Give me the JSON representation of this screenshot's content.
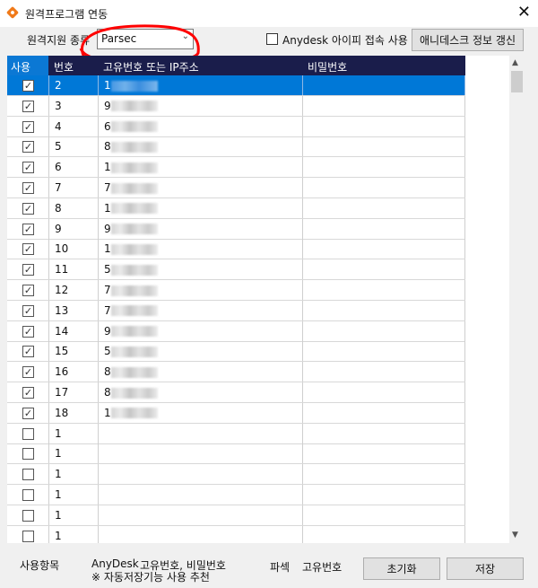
{
  "window": {
    "title": "원격프로그램 연동",
    "close_icon": "close-icon",
    "app_icon": "app-icon",
    "accent": "#0078d7",
    "header_bg": "#1a1d4b"
  },
  "toolbar": {
    "remote_type_label": "원격지원 종류",
    "remote_type_value": "Parsec",
    "anydesk_ip_label": "Anydesk 아이피 접속 사용",
    "anydesk_ip_checked": false,
    "refresh_button": "애니데스크 정보 갱신"
  },
  "table": {
    "columns": [
      "사용",
      "번호",
      "고유번호 또는 IP주소",
      "비밀번호"
    ],
    "rows": [
      {
        "use": true,
        "no": "2",
        "id_prefix": "1",
        "password": ""
      },
      {
        "use": true,
        "no": "3",
        "id_prefix": "9",
        "password": ""
      },
      {
        "use": true,
        "no": "4",
        "id_prefix": "6",
        "password": ""
      },
      {
        "use": true,
        "no": "5",
        "id_prefix": "8",
        "password": ""
      },
      {
        "use": true,
        "no": "6",
        "id_prefix": "1",
        "password": ""
      },
      {
        "use": true,
        "no": "7",
        "id_prefix": "7",
        "password": ""
      },
      {
        "use": true,
        "no": "8",
        "id_prefix": "1",
        "password": ""
      },
      {
        "use": true,
        "no": "9",
        "id_prefix": "9",
        "password": ""
      },
      {
        "use": true,
        "no": "10",
        "id_prefix": "1",
        "password": ""
      },
      {
        "use": true,
        "no": "11",
        "id_prefix": "5",
        "password": ""
      },
      {
        "use": true,
        "no": "12",
        "id_prefix": "7",
        "password": ""
      },
      {
        "use": true,
        "no": "13",
        "id_prefix": "7",
        "password": ""
      },
      {
        "use": true,
        "no": "14",
        "id_prefix": "9",
        "password": ""
      },
      {
        "use": true,
        "no": "15",
        "id_prefix": "5",
        "password": ""
      },
      {
        "use": true,
        "no": "16",
        "id_prefix": "8",
        "password": ""
      },
      {
        "use": true,
        "no": "17",
        "id_prefix": "8",
        "password": ""
      },
      {
        "use": true,
        "no": "18",
        "id_prefix": "1",
        "password": ""
      },
      {
        "use": false,
        "no": "1",
        "id_prefix": "",
        "password": ""
      },
      {
        "use": false,
        "no": "1",
        "id_prefix": "",
        "password": ""
      },
      {
        "use": false,
        "no": "1",
        "id_prefix": "",
        "password": ""
      },
      {
        "use": false,
        "no": "1",
        "id_prefix": "",
        "password": ""
      },
      {
        "use": false,
        "no": "1",
        "id_prefix": "",
        "password": ""
      },
      {
        "use": false,
        "no": "1",
        "id_prefix": "",
        "password": ""
      }
    ],
    "selected_row": 0
  },
  "footer": {
    "items_label": "사용항목",
    "anydesk_label": "AnyDesk",
    "anydesk_fields": "고유번호, 비밀번호",
    "note": "※ 자동저장기능 사용 추천",
    "parsec_label": "파섹",
    "parsec_fields": "고유번호",
    "reset_button": "초기화",
    "save_button": "저장"
  }
}
